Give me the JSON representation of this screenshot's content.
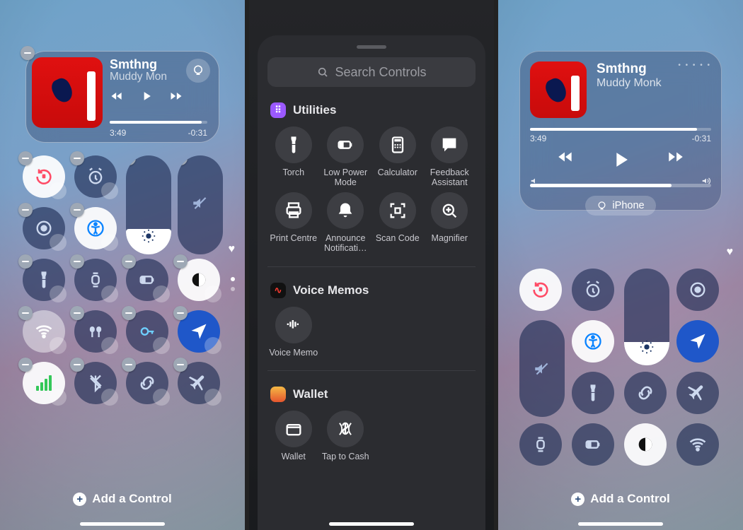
{
  "panel1": {
    "music": {
      "title": "Smthng",
      "artist": "Muddy Mon",
      "elapsed": "3:49",
      "remaining": "-0:31"
    },
    "add_label": "Add a Control",
    "controls_row1": [
      {
        "name": "rotation-lock",
        "active": true
      },
      {
        "name": "alarm"
      },
      {
        "name": "brightness-slider",
        "type": "slider"
      },
      {
        "name": "volume-slider",
        "type": "slider",
        "muted": true
      }
    ],
    "controls_row2": [
      {
        "name": "screen-record"
      },
      {
        "name": "accessibility",
        "active": true
      }
    ],
    "controls_row3": [
      {
        "name": "torch"
      },
      {
        "name": "watch"
      },
      {
        "name": "low-power"
      },
      {
        "name": "dark-mode",
        "active": true
      }
    ],
    "controls_row4": [
      {
        "name": "wifi"
      },
      {
        "name": "airpods"
      },
      {
        "name": "passwords"
      },
      {
        "name": "location",
        "active_blue": true
      }
    ],
    "controls_row5": [
      {
        "name": "cellular",
        "active": true
      },
      {
        "name": "bluetooth-off"
      },
      {
        "name": "link-rotation"
      },
      {
        "name": "airplane-mode"
      }
    ]
  },
  "panel2": {
    "search_placeholder": "Search Controls",
    "sections": [
      {
        "title": "Utilities",
        "chip_color": "#9b59ff",
        "chip_glyph": "⠿",
        "items": [
          {
            "name": "torch",
            "label": "Torch"
          },
          {
            "name": "low-power",
            "label": "Low Power Mode"
          },
          {
            "name": "calculator",
            "label": "Calculator"
          },
          {
            "name": "feedback",
            "label": "Feedback Assistant"
          },
          {
            "name": "print",
            "label": "Print Centre"
          },
          {
            "name": "announce",
            "label": "Announce Notificati…"
          },
          {
            "name": "scan-code",
            "label": "Scan Code"
          },
          {
            "name": "magnifier",
            "label": "Magnifier"
          }
        ]
      },
      {
        "title": "Voice Memos",
        "chip_color": "#000",
        "chip_glyph": "∿",
        "items": [
          {
            "name": "voice-memo",
            "label": "Voice Memo"
          }
        ]
      },
      {
        "title": "Wallet",
        "chip_color": "#000",
        "chip_glyph": "💳",
        "items": [
          {
            "name": "wallet",
            "label": "Wallet"
          },
          {
            "name": "tap-to-cash",
            "label": "Tap to Cash"
          }
        ]
      }
    ]
  },
  "panel3": {
    "music": {
      "title": "Smthng",
      "artist": "Muddy Monk",
      "elapsed": "3:49",
      "remaining": "-0:31",
      "route_label": "iPhone"
    },
    "add_label": "Add a Control",
    "grid": [
      {
        "name": "rotation-lock",
        "active": true
      },
      {
        "name": "alarm"
      },
      {
        "name": "brightness-slider",
        "type": "slider"
      },
      {
        "name": "screen-record"
      },
      {
        "name": "volume-slider",
        "type": "slider",
        "muted": true
      },
      {
        "name": "accessibility",
        "active": true
      },
      null,
      {
        "name": "location",
        "active_blue": true
      },
      {
        "name": "watch"
      },
      {
        "name": "torch"
      },
      {
        "name": "link-rotation"
      },
      {
        "name": "airplane-mode"
      },
      {
        "name": "watch"
      },
      {
        "name": "low-power"
      },
      {
        "name": "dark-mode",
        "active": true,
        "light": true
      },
      {
        "name": "wifi"
      }
    ]
  }
}
